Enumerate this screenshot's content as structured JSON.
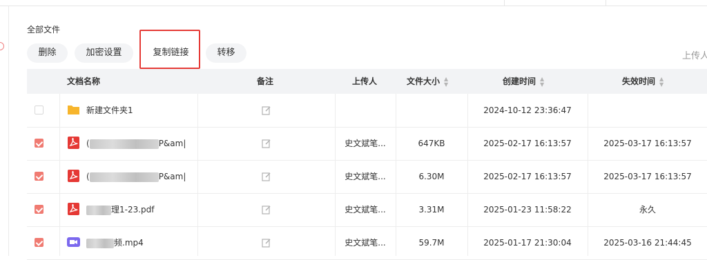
{
  "breadcrumb": "全部文件",
  "toolbar": {
    "delete_label": "删除",
    "encrypt_label": "加密设置",
    "copy_link_label": "复制链接",
    "move_label": "转移"
  },
  "uploader_filter_label": "上传人",
  "columns": {
    "name": "文档名称",
    "note": "备注",
    "uploader": "上传人",
    "size": "文件大小",
    "created": "创建时间",
    "expire": "失效时间"
  },
  "rows": [
    {
      "checked": false,
      "type": "folder",
      "name_prefix": "",
      "name": "新建文件夹1",
      "uploader": "",
      "size": "",
      "created": "2024-10-12 23:36:47",
      "expire": ""
    },
    {
      "checked": true,
      "type": "pdf",
      "name_prefix": "(",
      "name": "P&am|",
      "uploader": "史文斌笔...",
      "size": "647KB",
      "created": "2025-02-17 16:13:57",
      "expire": "2025-03-17 16:13:57"
    },
    {
      "checked": true,
      "type": "pdf",
      "name_prefix": "(",
      "name": "P&am|",
      "uploader": "史文斌笔...",
      "size": "6.30M",
      "created": "2025-02-17 16:13:57",
      "expire": "2025-03-17 16:13:57"
    },
    {
      "checked": true,
      "type": "pdf",
      "name_prefix": "",
      "name": "理1-23.pdf",
      "uploader": "史文斌笔...",
      "size": "3.31M",
      "created": "2025-01-23 11:58:22",
      "expire": "永久"
    },
    {
      "checked": true,
      "type": "video",
      "name_prefix": "",
      "name": "频.mp4",
      "uploader": "史文斌笔...",
      "size": "59.7M",
      "created": "2025-01-17 21:30:04",
      "expire": "2025-03-16 21:44:45"
    }
  ],
  "colors": {
    "accent": "#f07b72",
    "highlight_box": "#e53935",
    "pdf_icon": "#e53935",
    "folder_icon": "#f7b52c",
    "video_icon": "#7b68ee"
  },
  "icons": {
    "pdf": "pdf-icon",
    "folder": "folder-icon",
    "video": "video-icon",
    "note": "edit-icon",
    "sort": "sort-caret-icon"
  }
}
